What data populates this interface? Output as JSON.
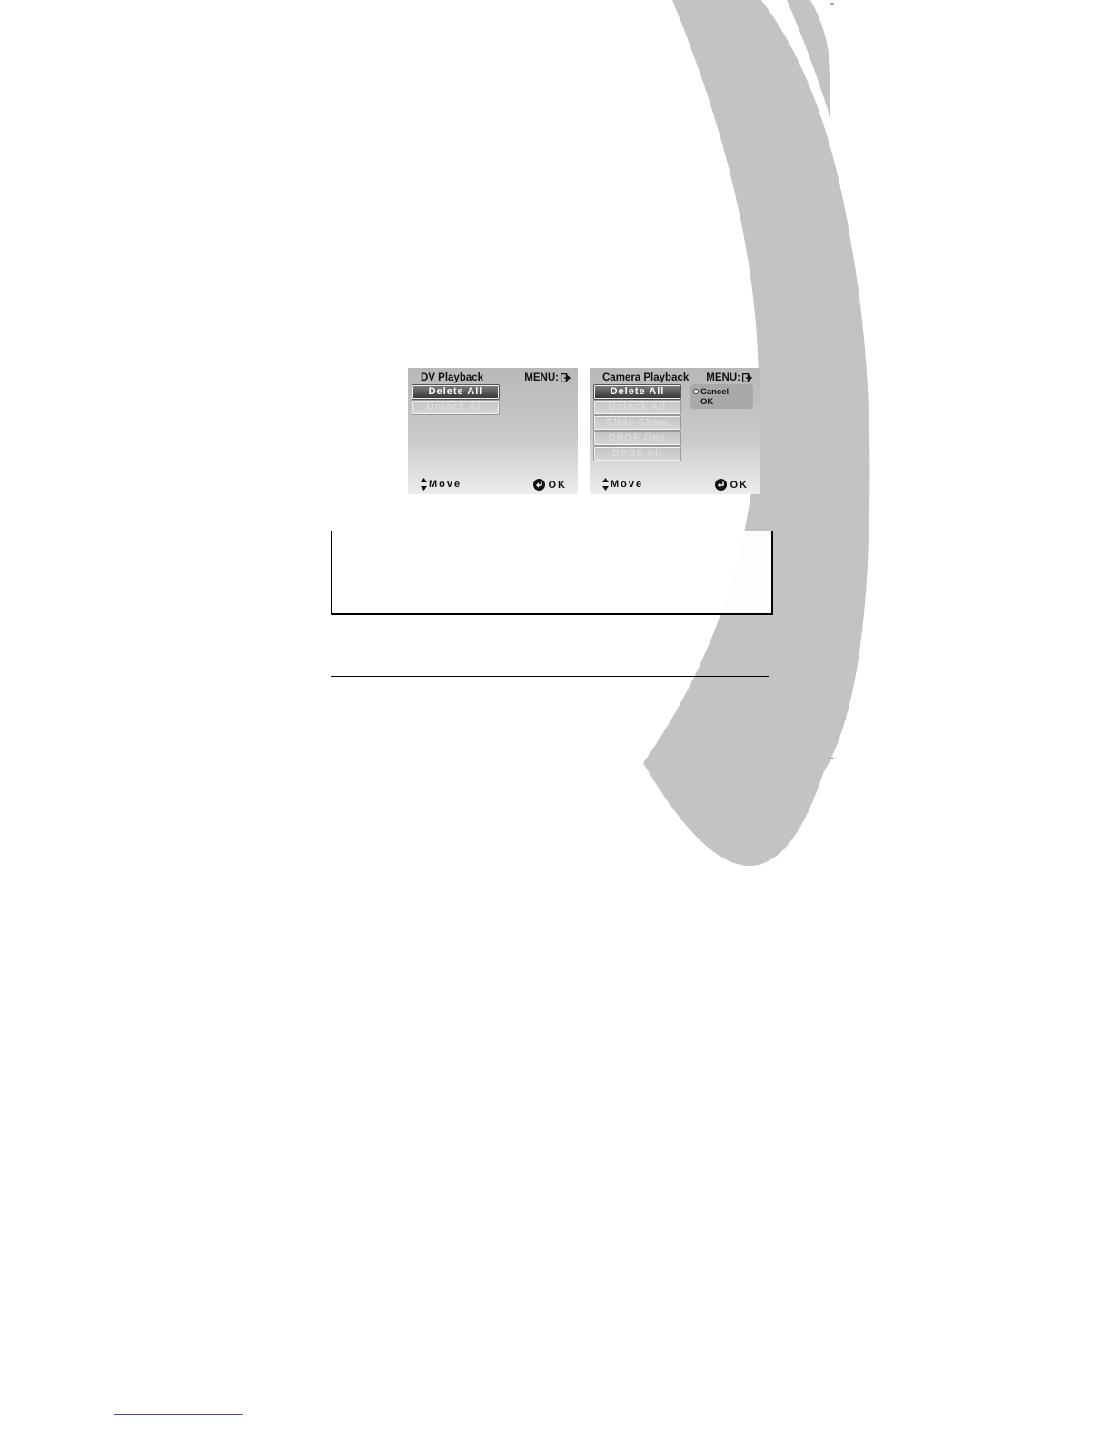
{
  "screens": {
    "dv_playback": {
      "title": "DV Playback",
      "menu_label": "MENU:",
      "items": [
        "Delete All",
        "Unlock All"
      ],
      "selected_index": 0,
      "move_label": "Move",
      "ok_label": "OK"
    },
    "camera_playback": {
      "title": "Camera Playback",
      "menu_label": "MENU:",
      "items": [
        "Delete All",
        "Unlock All",
        "Slide Show",
        "DPOF One",
        "DPOF All"
      ],
      "selected_index": 0,
      "popup": {
        "options": [
          "Cancel",
          "OK"
        ],
        "selected_index": 0
      },
      "move_label": "Move",
      "ok_label": "OK"
    }
  },
  "icons": {
    "menu_exit": "exit-icon",
    "move": "up-down-arrows-icon",
    "ok": "enter-icon",
    "popup_selector": "radio-dot-icon"
  },
  "colors": {
    "decorative_arc": "#c3c3c3",
    "screen_top": "#b8b8b8",
    "screen_bottom": "#ececec",
    "selected_item": "#3a3a3a"
  }
}
